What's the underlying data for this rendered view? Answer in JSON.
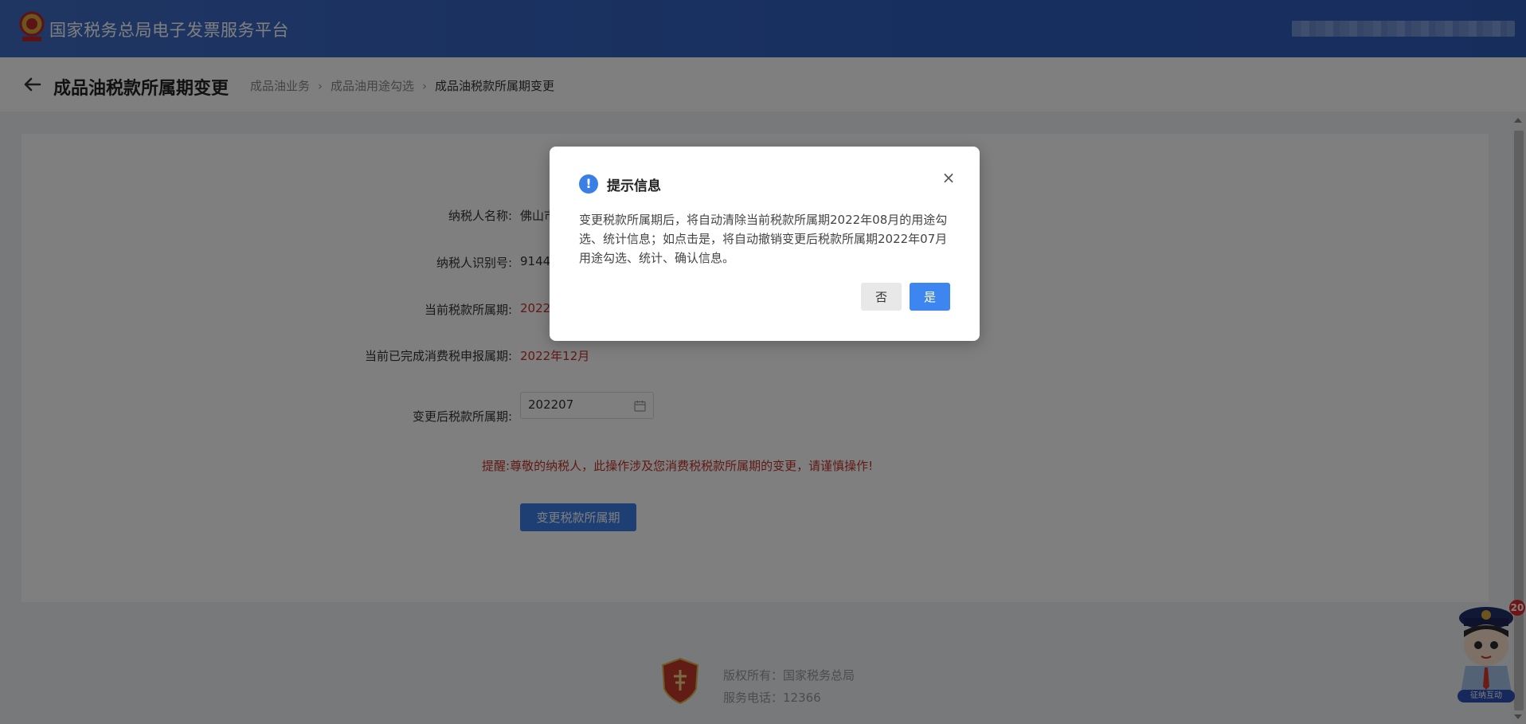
{
  "header": {
    "site_title": "国家税务总局电子发票服务平台"
  },
  "subheader": {
    "page_title": "成品油税款所属期变更",
    "breadcrumb": [
      "成品油业务",
      "成品油用途勾选",
      "成品油税款所属期变更"
    ]
  },
  "form": {
    "taxpayer_name_label": "纳税人名称:",
    "taxpayer_name_value": "佛山市",
    "taxpayer_id_label": "纳税人识别号:",
    "taxpayer_id_value": "9144",
    "current_period_label": "当前税款所属期:",
    "current_period_value": "2022",
    "completed_period_label": "当前已完成消费税申报属期:",
    "completed_period_value": "2022年12月",
    "new_period_label": "变更后税款所属期:",
    "new_period_value": "202207",
    "warning_label": "提醒:",
    "warning_text": "尊敬的纳税人，此操作涉及您消费税税款所属期的变更，请谨慎操作!",
    "submit_label": "变更税款所属期"
  },
  "footer": {
    "copyright": "版权所有：国家税务总局",
    "hotline": "服务电话：12366"
  },
  "assistant": {
    "badge": "20",
    "label": "征纳互动"
  },
  "dialog": {
    "title": "提示信息",
    "message": "变更税款所属期后，将自动清除当前税款所属期2022年08月的用途勾选、统计信息；如点击是，将自动撤销变更后税款所属期2022年07月用途勾选、统计、确认信息。",
    "no_label": "否",
    "yes_label": "是"
  },
  "colors": {
    "header_blue": "#3f6cc6",
    "primary_button": "#3d7ee6",
    "alert_red": "#c0342a"
  }
}
